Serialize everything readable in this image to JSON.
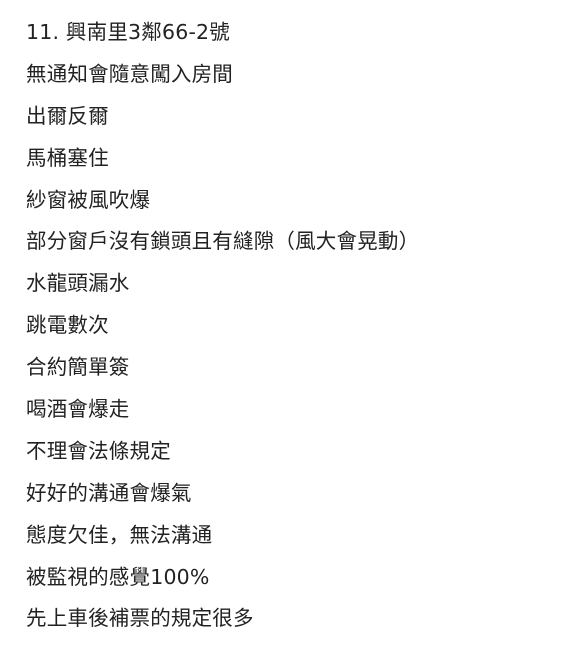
{
  "document": {
    "lines": [
      "11. 興南里3鄰66-2號",
      "無通知會隨意闖入房間",
      "出爾反爾",
      "馬桶塞住",
      "紗窗被風吹爆",
      "部分窗戶沒有鎖頭且有縫隙（風大會晃動）",
      "水龍頭漏水",
      "跳電數次",
      "合約簡單簽",
      "喝酒會爆走",
      "不理會法條規定",
      "好好的溝通會爆氣",
      "態度欠佳，無法溝通",
      "被監視的感覺100%",
      "先上車後補票的規定很多"
    ]
  }
}
